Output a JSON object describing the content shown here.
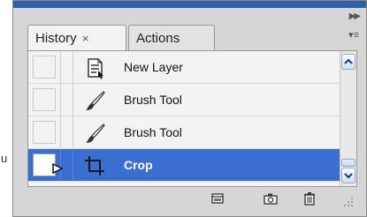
{
  "background": {
    "glyph": "u"
  },
  "panel": {
    "tabs": [
      {
        "label": "History",
        "close": "×",
        "active": true
      },
      {
        "label": "Actions",
        "active": false
      }
    ],
    "collapse_icon": "double-right-arrow-icon",
    "menu_icon": "panel-menu-icon"
  },
  "history": {
    "items": [
      {
        "label": "New Layer",
        "icon": "new-layer-icon",
        "selected": false
      },
      {
        "label": "Brush Tool",
        "icon": "brush-icon",
        "selected": false
      },
      {
        "label": "Brush Tool",
        "icon": "brush-icon",
        "selected": false
      },
      {
        "label": "Crop",
        "icon": "crop-icon",
        "selected": true
      }
    ]
  },
  "footer": {
    "buttons": [
      {
        "name": "new-document-from-state",
        "icon": "new-document-icon"
      },
      {
        "name": "create-snapshot",
        "icon": "camera-icon"
      },
      {
        "name": "delete-state",
        "icon": "trash-icon"
      }
    ]
  },
  "colors": {
    "selection": "#3a6fd1",
    "panel_bg": "#d6d6d6",
    "content_bg": "#f3f3f3",
    "header_strip": "#2f5fa7"
  }
}
